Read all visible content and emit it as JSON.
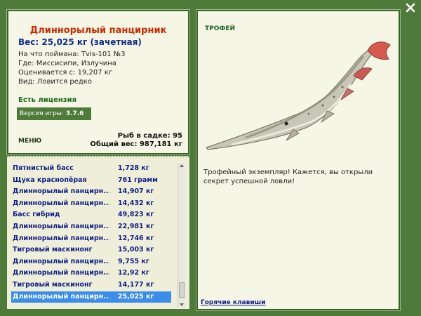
{
  "fish": {
    "title": "Длиннорылый панцирник",
    "weight": "Вес: 25,025 кг (зачетная)",
    "bait": "На что поймана: Tvis-101 №3",
    "place": "Где: Миссисипи, Излучина",
    "value": "Оценивается с: 19,207 кг",
    "kind": "Вид: Ловится редко"
  },
  "license": "Есть лицензия",
  "version": {
    "label": "Версия игры:",
    "value": "3.7.6"
  },
  "menu": "МЕНЮ",
  "cage": {
    "count": "Рыб в садке: 95",
    "total": "Общий вес: 987,181 кг"
  },
  "catch_list": [
    {
      "name": "Пятнистый басс",
      "weight": "1,728 кг"
    },
    {
      "name": "Щука краснопёрая",
      "weight": "761 грамм"
    },
    {
      "name": "Длиннорылый панцирник",
      "weight": "14,907 кг"
    },
    {
      "name": "Длиннорылый панцирник",
      "weight": "14,432 кг"
    },
    {
      "name": "Басс гибрид",
      "weight": "49,823 кг"
    },
    {
      "name": "Длиннорылый панцирник",
      "weight": "22,981 кг"
    },
    {
      "name": "Длиннорылый панцирник",
      "weight": "12,746 кг"
    },
    {
      "name": "Тигровый маскинонг",
      "weight": "15,003 кг"
    },
    {
      "name": "Длиннорылый панцирник",
      "weight": "9,755 кг"
    },
    {
      "name": "Длиннорылый панцирник",
      "weight": "12,92 кг"
    },
    {
      "name": "Тигровый маскинонг",
      "weight": "14,177 кг"
    },
    {
      "name": "Длиннорылый панцирник",
      "weight": "25,025 кг"
    }
  ],
  "selected_index": 11,
  "trophy": {
    "label": "ТРОФЕЙ",
    "text": "Трофейный экземпляр! Кажется, вы открыли секрет успешной ловли!"
  },
  "hotkeys": "Горячие клавиши",
  "colors": {
    "background": "#4e7a3a",
    "panel": "#f6f6e6",
    "title": "#cc2a00",
    "link": "#0d1f8a",
    "selection": "#3a8de8"
  }
}
